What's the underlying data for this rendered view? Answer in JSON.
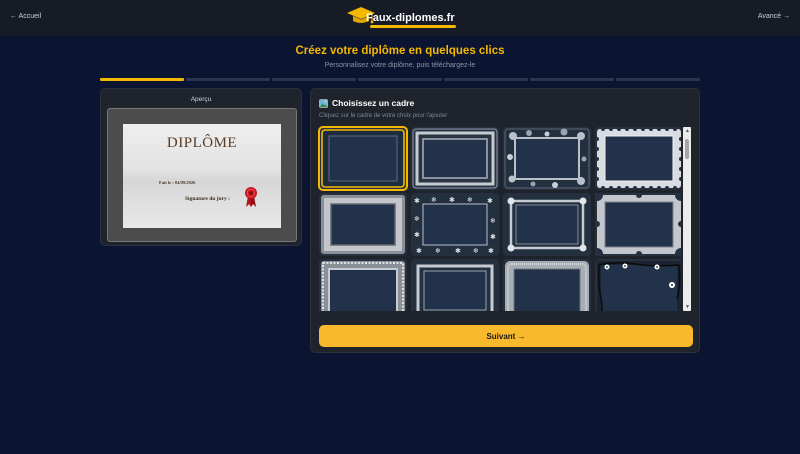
{
  "nav": {
    "back_label": "← Accueil",
    "advanced_label": "Avancé →"
  },
  "logo": {
    "text": "Faux-diplomes.fr",
    "icon": "graduation-cap-icon",
    "accent": "#f5b800"
  },
  "header": {
    "title": "Créez votre diplôme en quelques clics",
    "subtitle": "Personnalisez votre diplôme, puis téléchargez-le"
  },
  "progress": {
    "total_steps": 7,
    "current_step": 1
  },
  "preview": {
    "label": "Aperçu",
    "diploma_title": "DIPLÔME",
    "date_text": "Fait le : 04/09/2026",
    "signature_text": "Signature du jury :",
    "seal_icon": "wax-seal-icon"
  },
  "frames": {
    "icon": "picture-icon",
    "title": "Choisissez un cadre",
    "hint": "Cliquez sur le cadre de votre choix pour l'ajouter",
    "items": [
      {
        "name": "frame-plain-yellow",
        "selected": true
      },
      {
        "name": "frame-silver-double",
        "selected": false
      },
      {
        "name": "frame-bubbles",
        "selected": false
      },
      {
        "name": "frame-scalloped",
        "selected": false
      },
      {
        "name": "frame-thick-silver",
        "selected": false
      },
      {
        "name": "frame-snowflakes",
        "selected": false
      },
      {
        "name": "frame-ornate-corners",
        "selected": false
      },
      {
        "name": "frame-notched",
        "selected": false
      },
      {
        "name": "frame-dotted-silver",
        "selected": false
      },
      {
        "name": "frame-classic-silver",
        "selected": false
      },
      {
        "name": "frame-textured",
        "selected": false
      },
      {
        "name": "frame-floral-black",
        "selected": false
      }
    ],
    "next_label": "Suivant →"
  },
  "colors": {
    "accent": "#f5b800",
    "background": "#0b1431",
    "panel": "#1f232b"
  }
}
